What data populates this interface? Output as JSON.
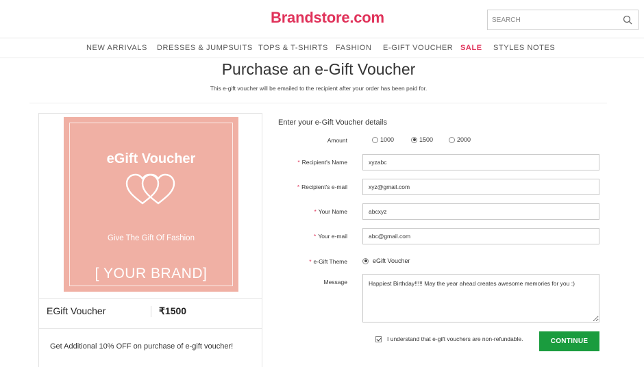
{
  "header": {
    "logo": "Brandstore.com",
    "search_placeholder": "SEARCH"
  },
  "nav": {
    "items": [
      "NEW ARRIVALS",
      "DRESSES & JUMPSUITS",
      "TOPS & T-SHIRTS",
      "FASHION",
      "E-GIFT VOUCHER",
      "SALE",
      "STYLES NOTES"
    ]
  },
  "page": {
    "title": "Purchase an e-Gift Voucher",
    "subtitle": "This e-gift voucher will be emailed to the recipient after your order has been paid for."
  },
  "card": {
    "voucher_title": "eGift Voucher",
    "tagline": "Give The Gift Of Fashion",
    "brand": "[ YOUR BRAND]",
    "name": "EGift Voucher",
    "price": "₹1500",
    "offer": "Get Additional 10% OFF on purchase of e-gift voucher!",
    "voucher_color": "#f0b0a4"
  },
  "form": {
    "heading": "Enter your e-Gift Voucher details",
    "amount_label": "Amount",
    "amount_options": [
      "1000",
      "1500",
      "2000"
    ],
    "amount_selected": "1500",
    "required_mark": "*",
    "recipient_name_label": "Recipient's Name",
    "recipient_name_value": "xyzabc",
    "recipient_email_label": "Recipient's e-mail",
    "recipient_email_value": "xyz@gmail.com",
    "your_name_label": "Your Name",
    "your_name_value": "abcxyz",
    "your_email_label": "Your e-mail",
    "your_email_value": "abc@gmail.com",
    "theme_label": "e-Gift Theme",
    "theme_value": "eGift Voucher",
    "message_label": "Message",
    "message_value": "Happiest Birthday!!!!! May the year ahead creates awesome memories for you :)",
    "agree_text": "I understand that e-gift vouchers are non-refundable.",
    "agree_checked": true,
    "continue_label": "CONTINUE"
  },
  "colors": {
    "brand": "#e0325a",
    "continue": "#1a9c3e"
  }
}
